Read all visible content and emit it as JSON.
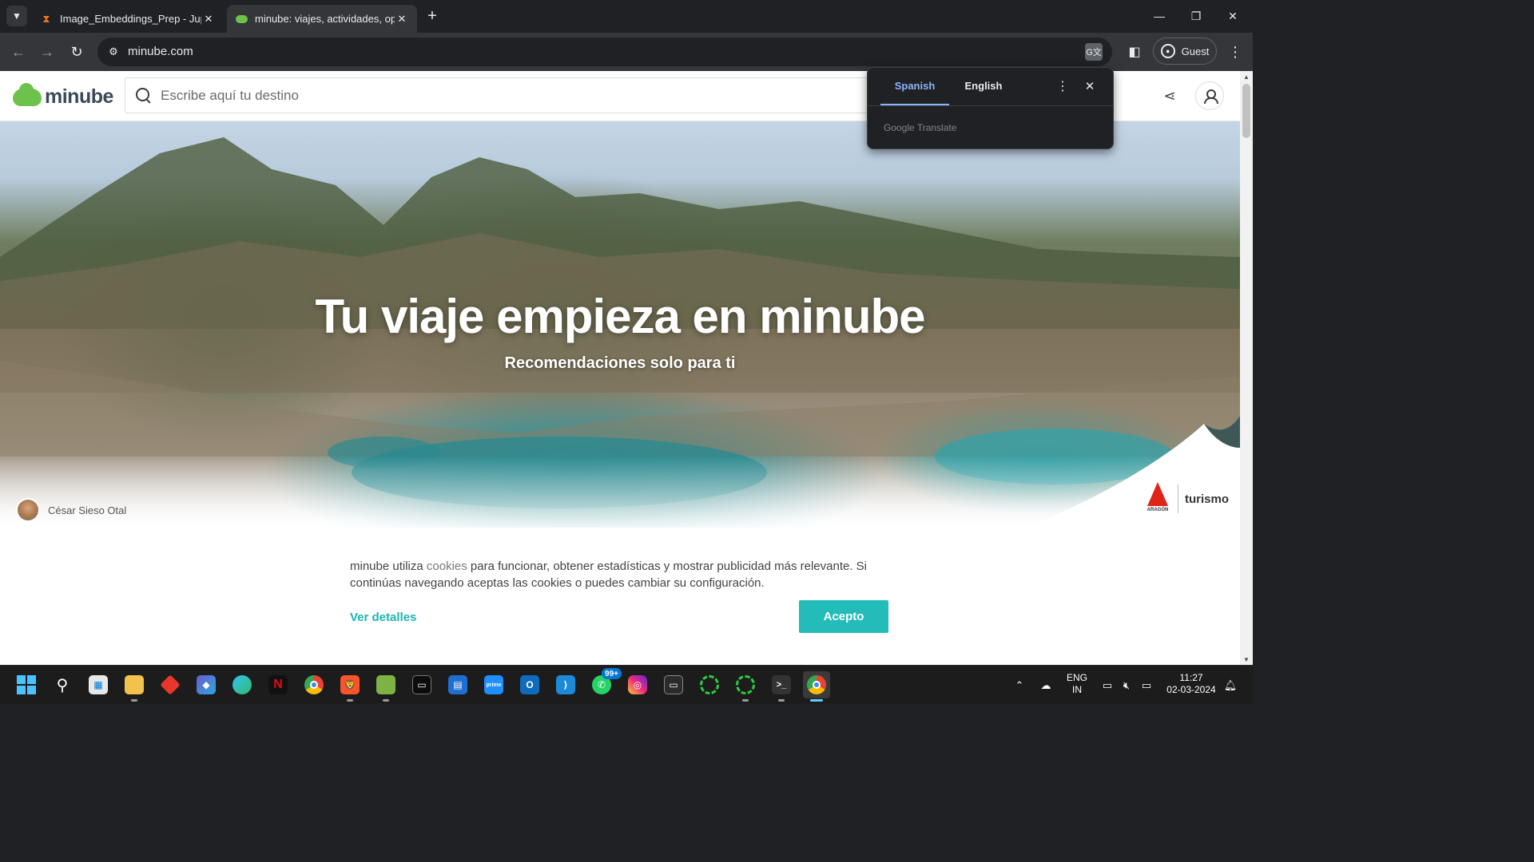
{
  "browser": {
    "tabs": [
      {
        "title": "Image_Embeddings_Prep - Jupyter",
        "icon": "hourglass-icon",
        "active": false
      },
      {
        "title": "minube: viajes, actividades, opiniones",
        "icon": "minube-cloud-icon",
        "active": true
      }
    ],
    "url": "minube.com",
    "profile_label": "Guest"
  },
  "site": {
    "logo_text": "minube",
    "search_placeholder": "Escribe aquí tu destino",
    "hero_title": "Tu viaje empieza en minube",
    "hero_subtitle": "Recomendaciones solo para ti",
    "photo_author": "César Sieso Otal",
    "sponsor": {
      "brand_sub": "ARAGÓN",
      "label": "turismo"
    }
  },
  "cookie_banner": {
    "text_before": "minube utiliza ",
    "link_text": "cookies",
    "text_after": " para funcionar, obtener estadísticas y mostrar publicidad más relevante. Si continúas navegando aceptas las cookies o puedes cambiar su configuración.",
    "details_label": "Ver detalles",
    "accept_label": "Acepto"
  },
  "translate_popup": {
    "languages": [
      "Spanish",
      "English"
    ],
    "active_language": "Spanish",
    "brand": "Google Translate"
  },
  "taskbar": {
    "apps": [
      "start",
      "search",
      "store",
      "file-explorer",
      "app-red",
      "copilot",
      "edge",
      "netflix",
      "chrome",
      "brave",
      "notepad-plus",
      "terminal",
      "widgets",
      "prime-video",
      "outlook",
      "vscode",
      "whatsapp",
      "instagram",
      "terminal-2",
      "spinner-1",
      "spinner-2",
      "cmd",
      "chrome-active"
    ],
    "whatsapp_badge": "99+",
    "language": "ENG",
    "region": "IN",
    "time": "11:27",
    "date": "02-03-2024"
  },
  "colors": {
    "accent_teal": "#23bcb9",
    "minube_green": "#6cc24a",
    "translate_blue": "#8ab4f8"
  }
}
